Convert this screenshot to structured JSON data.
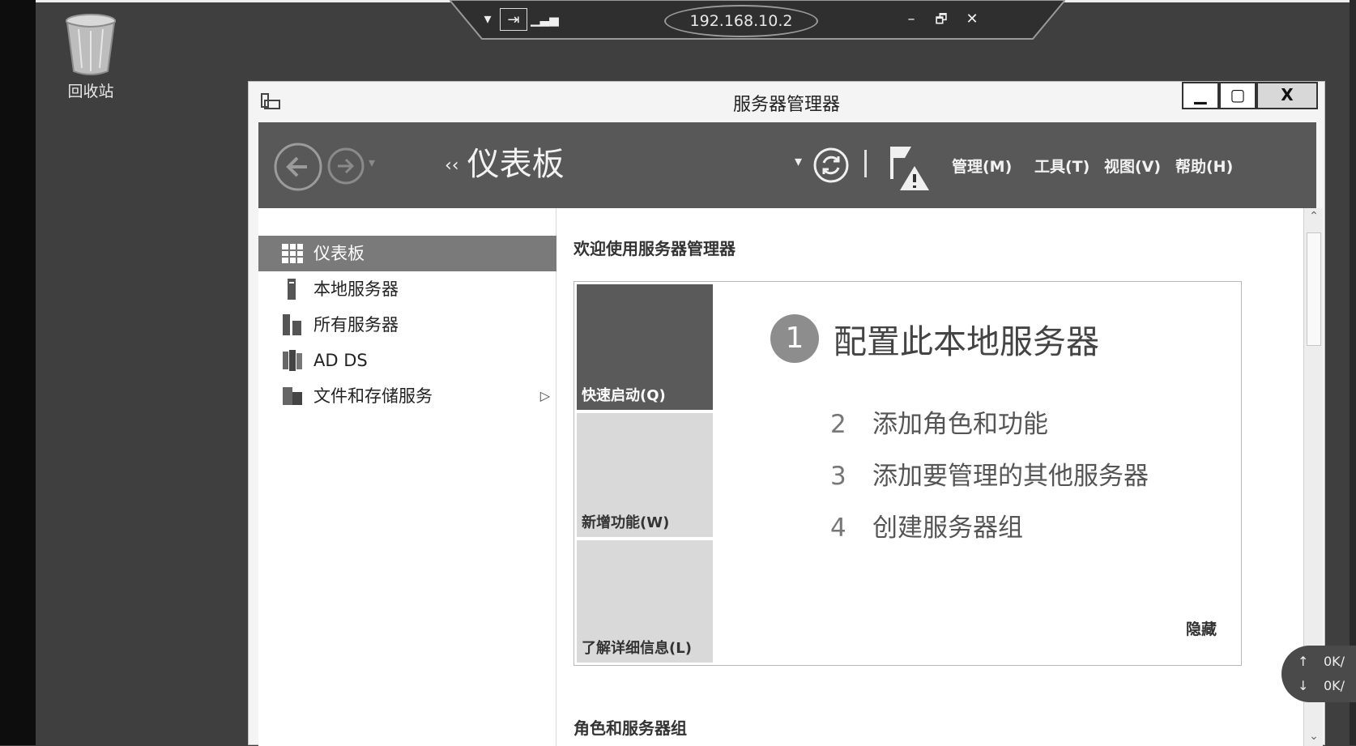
{
  "desktop": {
    "recycle_bin_label": "回收站"
  },
  "rdp_bar": {
    "ip": "192.168.10.2",
    "minimize": "–",
    "restore": "🗗",
    "close": "✕"
  },
  "window": {
    "title": "服务器管理器",
    "min_label": "▁",
    "max_label": "▢",
    "close_label": "X"
  },
  "navbar": {
    "breadcrumb_arrows": "‹‹",
    "title": "仪表板",
    "menus": [
      "管理(M)",
      "工具(T)",
      "视图(V)",
      "帮助(H)"
    ]
  },
  "sidebar": {
    "items": [
      {
        "label": "仪表板",
        "icon": "dashboard-grid-icon",
        "active": true
      },
      {
        "label": "本地服务器",
        "icon": "server-icon"
      },
      {
        "label": "所有服务器",
        "icon": "servers-icon"
      },
      {
        "label": "AD DS",
        "icon": "ad-ds-icon"
      },
      {
        "label": "文件和存储服务",
        "icon": "file-storage-icon",
        "expandable": true
      }
    ]
  },
  "main": {
    "welcome": "欢迎使用服务器管理器",
    "tiles": [
      "快速启动(Q)",
      "新增功能(W)",
      "了解详细信息(L)"
    ],
    "step1": {
      "num": "1",
      "text": "配置此本地服务器"
    },
    "steps": [
      {
        "num": "2",
        "text": "添加角色和功能"
      },
      {
        "num": "3",
        "text": "添加要管理的其他服务器"
      },
      {
        "num": "4",
        "text": "创建服务器组"
      }
    ],
    "hide": "隐藏",
    "roles_heading": "角色和服务器组"
  },
  "netspeed": {
    "up_arrow": "↑",
    "up": "0K/",
    "down_arrow": "↓",
    "down": "0K/"
  }
}
